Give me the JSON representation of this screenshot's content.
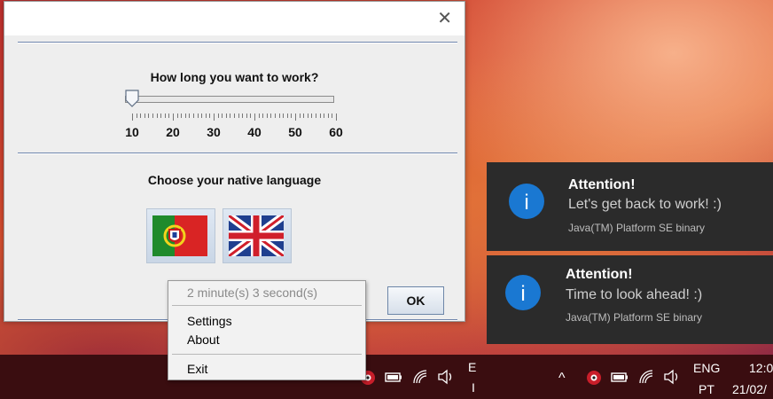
{
  "dialog": {
    "close_glyph": "✕",
    "work_label": "How long you want to work?",
    "slider": {
      "min": 10,
      "max": 60,
      "value": 10,
      "tick_labels": [
        "10",
        "20",
        "30",
        "40",
        "50",
        "60"
      ]
    },
    "language_label": "Choose your native language",
    "languages": [
      {
        "name": "portugal-flag-icon"
      },
      {
        "name": "uk-flag-icon"
      }
    ],
    "ok_label": "OK"
  },
  "context_menu": {
    "timer": "2 minute(s) 3 second(s)",
    "settings": "Settings",
    "about": "About",
    "exit": "Exit"
  },
  "notifications": [
    {
      "title": "Attention!",
      "message": "Let's get back to work! :)",
      "source": "Java(TM) Platform SE binary",
      "icon": "info-icon",
      "icon_glyph": "i"
    },
    {
      "title": "Attention!",
      "message": "Time to look ahead! :)",
      "source": "Java(TM) Platform SE binary",
      "icon": "info-icon",
      "icon_glyph": "i"
    }
  ],
  "taskbar": {
    "left_lang_top": "E",
    "left_lang_bottom": "I",
    "chevron": "^",
    "lang_top": "ENG",
    "lang_bottom": "PT",
    "time": "12:0",
    "date": "21/02/"
  }
}
